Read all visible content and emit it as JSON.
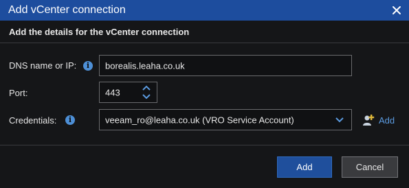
{
  "window": {
    "title": "Add vCenter connection",
    "close_label": "✕"
  },
  "subheader": {
    "text": "Add the details for the vCenter connection"
  },
  "form": {
    "dns": {
      "label": "DNS name or IP:",
      "value": "borealis.leaha.co.uk",
      "info_icon": "info-icon"
    },
    "port": {
      "label": "Port:",
      "value": "443"
    },
    "credentials": {
      "label": "Credentials:",
      "value": "veeam_ro@leaha.co.uk (VRO Service Account)",
      "info_icon": "info-icon",
      "add_label": "Add",
      "add_icon": "add-user-icon"
    }
  },
  "footer": {
    "add_button": "Add",
    "cancel_button": "Cancel"
  },
  "colors": {
    "titlebar": "#1d4d9e",
    "accent": "#4d8fd6",
    "link": "#5b9be0",
    "primary_button": "#1f4f9c",
    "background": "#151618"
  }
}
